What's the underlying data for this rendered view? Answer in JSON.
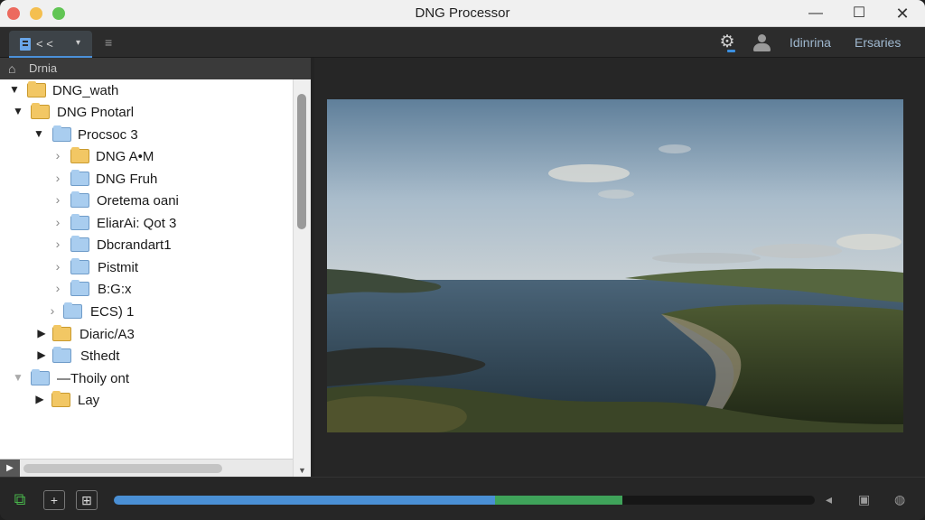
{
  "window": {
    "title": "DNG Processor"
  },
  "toolbar": {
    "tab_label": "< <",
    "links": [
      "Idinrina",
      "Ersaries"
    ]
  },
  "panel": {
    "header_label": "Drnia",
    "tree": [
      {
        "label": "DNG_wath",
        "folder": "yellow",
        "expanded": true
      },
      {
        "label": "DNG Pnotarl",
        "folder": "yellow",
        "expanded": true
      },
      {
        "label": "Procsoc 3",
        "folder": "blue",
        "expanded": true
      },
      {
        "label": "DNG A•M",
        "folder": "yellow",
        "expanded": false
      },
      {
        "label": "DNG Fruh",
        "folder": "blue",
        "expanded": false
      },
      {
        "label": "Oretema oani",
        "folder": "blue",
        "expanded": false
      },
      {
        "label": "EliarAi: Qot 3",
        "folder": "blue",
        "expanded": false
      },
      {
        "label": "Dbcrandart1",
        "folder": "blue",
        "expanded": false
      },
      {
        "label": "Pistmit",
        "folder": "blue",
        "expanded": false
      },
      {
        "label": "B:G:x",
        "folder": "blue",
        "expanded": false
      },
      {
        "label": "ECS) 1",
        "folder": "blue",
        "expanded": false
      },
      {
        "label": "Diaric/A3",
        "folder": "yellow",
        "expanded": false
      },
      {
        "label": "Sthedt",
        "folder": "blue",
        "expanded": false
      },
      {
        "label": "—Thoily ont",
        "folder": "blue",
        "expanded": true
      },
      {
        "label": "Lay",
        "folder": "yellow",
        "expanded": false
      }
    ]
  },
  "progress": {
    "blue_fraction": 0.544,
    "green_fraction": 0.182
  },
  "colors": {
    "accent": "#4a8fd4",
    "success": "#3fa35a",
    "folder_yellow": "#f2c764",
    "folder_blue": "#a9cdef"
  },
  "icons": [
    "file-icon",
    "menu-icon",
    "gear-icon",
    "user-icon",
    "home-icon",
    "folder-icon",
    "add-icon",
    "grid-icon",
    "volume-icon",
    "camera-icon",
    "globe-icon"
  ]
}
